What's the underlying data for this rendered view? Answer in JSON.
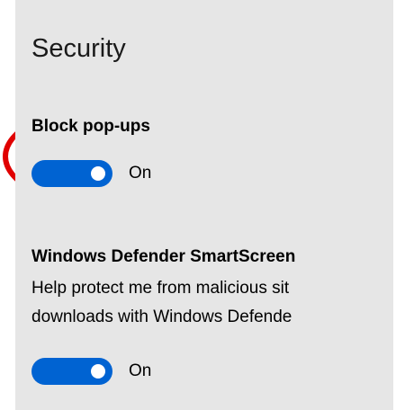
{
  "security": {
    "title": "Security"
  },
  "popups": {
    "heading": "Block pop-ups",
    "toggle_state": "On",
    "toggle_on": true
  },
  "smartscreen": {
    "heading": "Windows Defender SmartScreen",
    "description_line1": "Help protect me from malicious sit",
    "description_line2": "downloads with Windows Defende",
    "toggle_state": "On",
    "toggle_on": true
  },
  "colors": {
    "panel_background": "#e6e6e6",
    "toggle_accent": "#0063d2",
    "annotation": "#e00000"
  }
}
